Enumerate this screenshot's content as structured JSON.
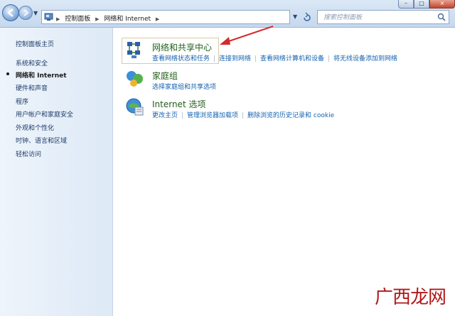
{
  "address_bar": {
    "path": [
      "控制面板",
      "网络和 Internet"
    ],
    "search_placeholder": "搜索控制面板"
  },
  "window_controls": {
    "minimize": "–",
    "maximize": "□",
    "close": "×"
  },
  "sidebar": {
    "items": [
      {
        "label": "控制面板主页",
        "current": false
      },
      {
        "label": "系统和安全",
        "current": false
      },
      {
        "label": "网络和 Internet",
        "current": true
      },
      {
        "label": "硬件和声音",
        "current": false
      },
      {
        "label": "程序",
        "current": false
      },
      {
        "label": "用户帐户和家庭安全",
        "current": false
      },
      {
        "label": "外观和个性化",
        "current": false
      },
      {
        "label": "时钟、语言和区域",
        "current": false
      },
      {
        "label": "轻松访问",
        "current": false
      }
    ]
  },
  "categories": [
    {
      "title": "网络和共享中心",
      "icon": "network-sharing-center-icon",
      "links": [
        "查看网络状态和任务",
        "连接到网络",
        "查看网络计算机和设备",
        "将无线设备添加到网络"
      ]
    },
    {
      "title": "家庭组",
      "icon": "homegroup-icon",
      "links": [
        "选择家庭组和共享选项"
      ]
    },
    {
      "title": "Internet 选项",
      "icon": "internet-options-icon",
      "links": [
        "更改主页",
        "管理浏览器加载项",
        "删除浏览的历史记录和 cookie"
      ]
    }
  ],
  "watermark": {
    "text": "广西龙网",
    "small": "网"
  },
  "colors": {
    "accent_link": "#1462b0",
    "category_title": "#1f5f18",
    "annotation_arrow": "#d42a2a",
    "watermark": "#b01818"
  }
}
